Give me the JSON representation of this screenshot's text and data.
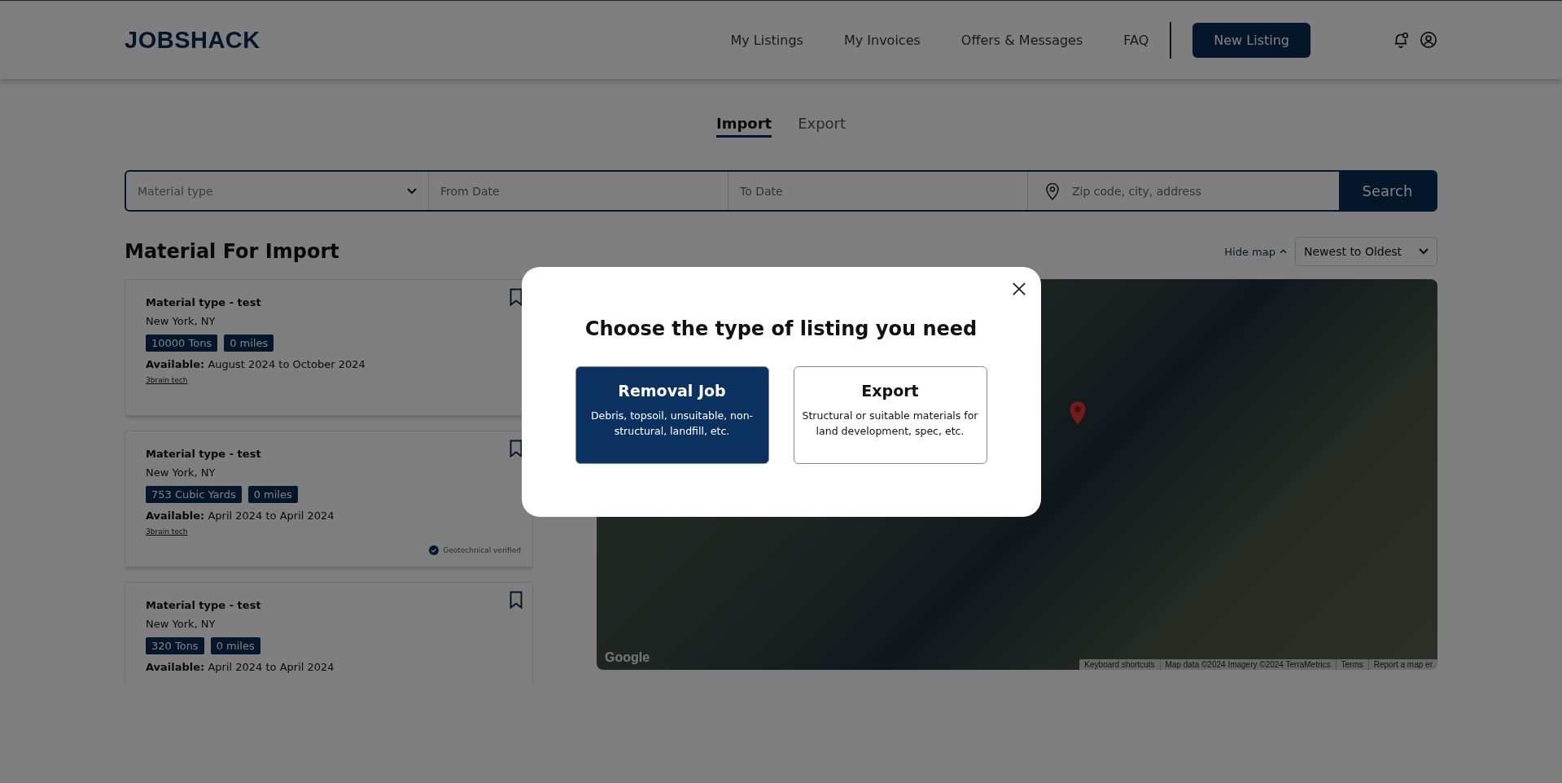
{
  "header": {
    "logo": "JOBSHACK",
    "nav": [
      {
        "label": "My Listings"
      },
      {
        "label": "My Invoices"
      },
      {
        "label": "Offers & Messages"
      },
      {
        "label": "FAQ"
      }
    ],
    "new_listing_button": "New Listing"
  },
  "tabs": [
    {
      "label": "Import",
      "selected": true
    },
    {
      "label": "Export",
      "selected": false
    }
  ],
  "search": {
    "material_placeholder": "Material type",
    "from_placeholder": "From Date",
    "to_placeholder": "To Date",
    "location_placeholder": "Zip code, city, address",
    "button": "Search"
  },
  "section_title": "Material For Import",
  "hide_map": "Hide map",
  "sort": "Newest to Oldest",
  "listings": [
    {
      "title": "Material type - test",
      "location": "New York, NY",
      "tags": [
        "10000 Tons",
        "0 miles"
      ],
      "available": "**Available:** August 2024 to October 2024",
      "company": "3brain tech"
    },
    {
      "title": "Material type - test",
      "location": "New York, NY",
      "tags": [
        "753 Cubic Yards",
        "0 miles"
      ],
      "available": "**Available:** April 2024 to April 2024",
      "company": "3brain tech",
      "verified_note": "Geotechnical verified"
    },
    {
      "title": "Material type - test",
      "location": "New York, NY",
      "tags": [
        "320 Tons",
        "0 miles"
      ],
      "available": "**Available:** April 2024 to April 2024"
    }
  ],
  "map": {
    "logo": "Google",
    "attribution": [
      "Keyboard shortcuts",
      "Map data ©2024 Imagery ©2024 TerraMetrics",
      "Terms",
      "Report a map er"
    ]
  },
  "modal": {
    "title": "Choose the type of listing you need",
    "options": [
      {
        "title": "Removal Job",
        "description": "Debris, topsoil, unsuitable, non-structural, landfill, etc.",
        "selected": true
      },
      {
        "title": "Export",
        "description": "Structural or suitable materials for land development, spec, etc.",
        "selected": false
      }
    ]
  }
}
